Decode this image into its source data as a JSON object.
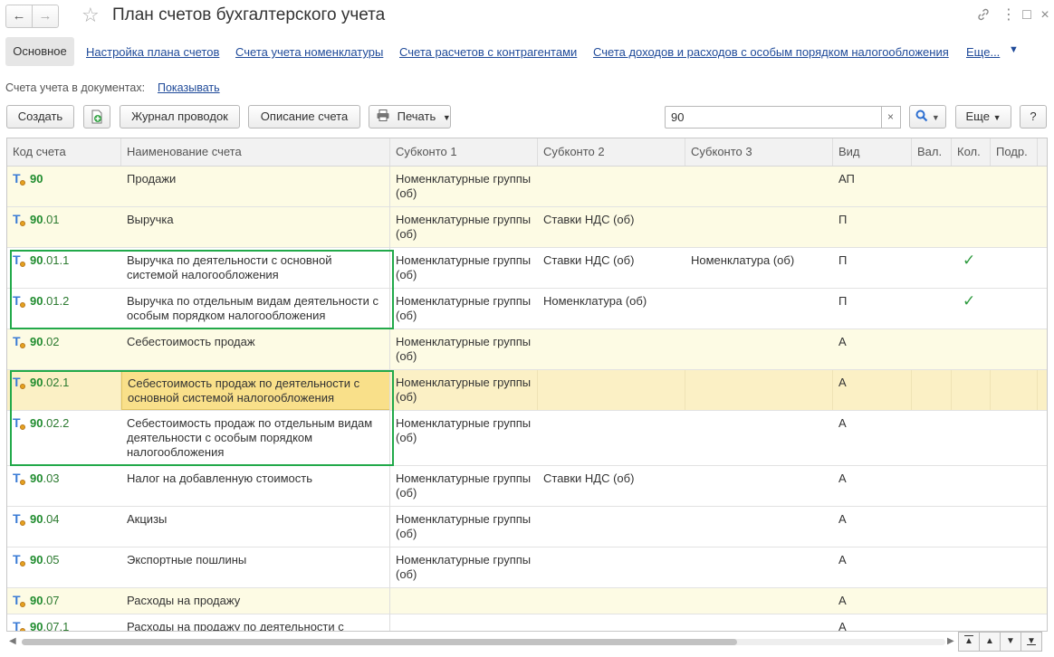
{
  "window": {
    "title": "План счетов бухгалтерского учета",
    "back_icon": "←",
    "forward_icon": "→",
    "star_icon": "☆",
    "link_icon": "🔗",
    "menu_icon": "⋮",
    "max_icon": "□",
    "close_icon": "×"
  },
  "tabs": {
    "active": "Основное",
    "links": [
      "Настройка плана счетов",
      "Счета учета номенклатуры",
      "Счета расчетов с контрагентами",
      "Счета доходов и расходов с особым порядком налогообложения",
      "Еще..."
    ]
  },
  "accounts_in_docs": {
    "label": "Счета учета в документах:",
    "link": "Показывать"
  },
  "toolbar": {
    "create": "Создать",
    "journal": "Журнал проводок",
    "description": "Описание счета",
    "print": "Печать",
    "search_value": "90",
    "more": "Еще",
    "help": "?"
  },
  "columns": [
    "Код счета",
    "Наименование счета",
    "Субконто 1",
    "Субконто 2",
    "Субконто 3",
    "Вид",
    "Вал.",
    "Кол.",
    "Подр."
  ],
  "rows": [
    {
      "prefix": "90",
      "suffix": "",
      "name": "Продажи",
      "s1": "Номенклатурные группы (об)",
      "s2": "",
      "s3": "",
      "kind": "АП",
      "qty": "",
      "group": true
    },
    {
      "prefix": "90",
      "suffix": ".01",
      "name": "Выручка",
      "s1": "Номенклатурные группы (об)",
      "s2": "Ставки НДС (об)",
      "s3": "",
      "kind": "П",
      "qty": "",
      "group": true
    },
    {
      "prefix": "90",
      "suffix": ".01.1",
      "name": "Выручка по деятельности с основной системой налогообложения",
      "s1": "Номенклатурные группы (об)",
      "s2": "Ставки НДС (об)",
      "s3": "Номенклатура (об)",
      "kind": "П",
      "qty": "✓"
    },
    {
      "prefix": "90",
      "suffix": ".01.2",
      "name": "Выручка по отдельным видам деятельности с особым порядком налогообложения",
      "s1": "Номенклатурные группы (об)",
      "s2": "Номенклатура (об)",
      "s3": "",
      "kind": "П",
      "qty": "✓"
    },
    {
      "prefix": "90",
      "suffix": ".02",
      "name": "Себестоимость продаж",
      "s1": "Номенклатурные группы (об)",
      "s2": "",
      "s3": "",
      "kind": "А",
      "qty": "",
      "group": true
    },
    {
      "prefix": "90",
      "suffix": ".02.1",
      "name": "Себестоимость продаж по деятельности с основной системой налогообложения",
      "s1": "Номенклатурные группы (об)",
      "s2": "",
      "s3": "",
      "kind": "А",
      "qty": "",
      "selected": true
    },
    {
      "prefix": "90",
      "suffix": ".02.2",
      "name": "Себестоимость продаж по отдельным видам деятельности с особым порядком налогообложения",
      "s1": "Номенклатурные группы (об)",
      "s2": "",
      "s3": "",
      "kind": "А",
      "qty": ""
    },
    {
      "prefix": "90",
      "suffix": ".03",
      "name": "Налог на добавленную стоимость",
      "s1": "Номенклатурные группы (об)",
      "s2": "Ставки НДС (об)",
      "s3": "",
      "kind": "А",
      "qty": ""
    },
    {
      "prefix": "90",
      "suffix": ".04",
      "name": "Акцизы",
      "s1": "Номенклатурные группы (об)",
      "s2": "",
      "s3": "",
      "kind": "А",
      "qty": ""
    },
    {
      "prefix": "90",
      "suffix": ".05",
      "name": "Экспортные пошлины",
      "s1": "Номенклатурные группы (об)",
      "s2": "",
      "s3": "",
      "kind": "А",
      "qty": ""
    },
    {
      "prefix": "90",
      "suffix": ".07",
      "name": "Расходы на продажу",
      "s1": "",
      "s2": "",
      "s3": "",
      "kind": "А",
      "qty": "",
      "group": true
    },
    {
      "prefix": "90",
      "suffix": ".07.1",
      "name": "Расходы на продажу по деятельности с",
      "s1": "",
      "s2": "",
      "s3": "",
      "kind": "А",
      "qty": ""
    }
  ],
  "pager": {
    "first": "▲",
    "up": "▲",
    "down": "▼",
    "last": "▼"
  }
}
